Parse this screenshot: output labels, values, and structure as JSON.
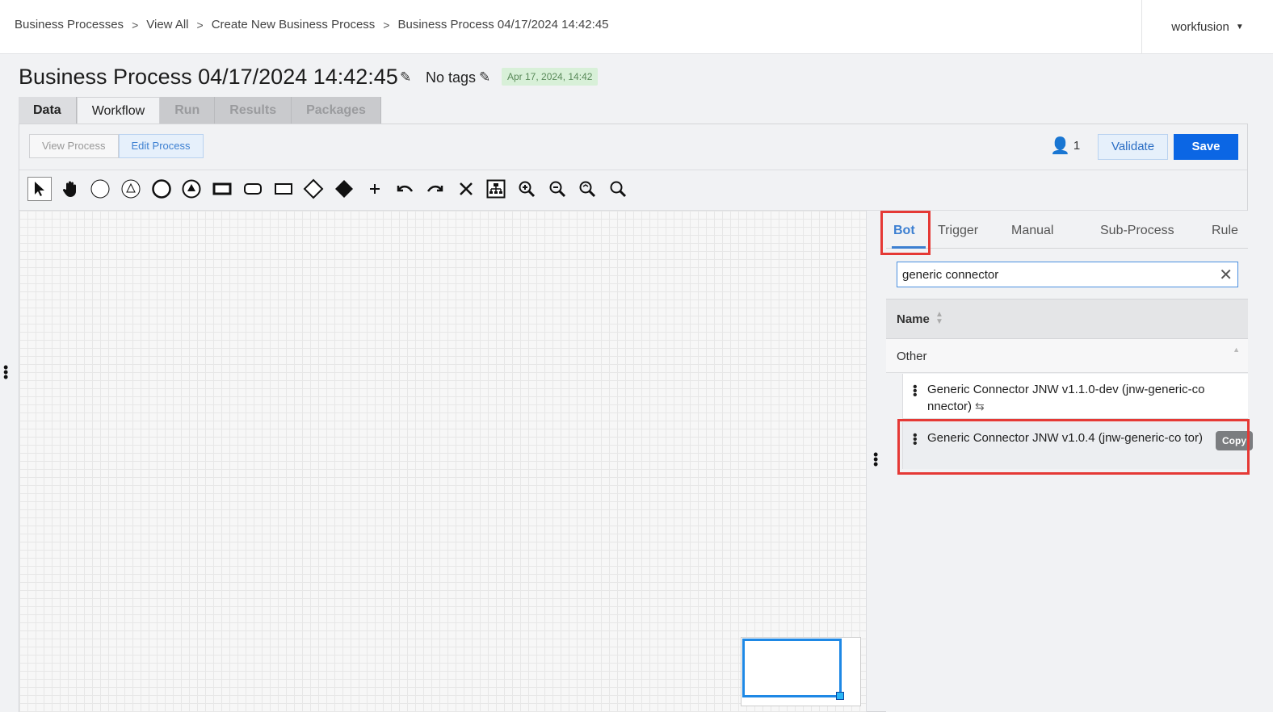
{
  "breadcrumb": [
    "Business Processes",
    "View All",
    "Create New Business Process",
    "Business Process 04/17/2024 14:42:45"
  ],
  "user": {
    "name": "workfusion"
  },
  "title": "Business Process 04/17/2024 14:42:45",
  "tags_label": "No tags",
  "date_badge": "Apr 17, 2024, 14:42",
  "tabs": [
    "Data",
    "Workflow",
    "Run",
    "Results",
    "Packages"
  ],
  "active_tab": "Workflow",
  "process_toggle": {
    "view": "View Process",
    "edit": "Edit Process",
    "active": "Edit Process"
  },
  "editors_count": "1",
  "buttons": {
    "validate": "Validate",
    "save": "Save"
  },
  "tools": [
    "pointer-tool",
    "hand-tool",
    "start-event",
    "start-event-signal",
    "end-event",
    "end-event-signal",
    "task",
    "subprocess",
    "data-object",
    "gateway-exclusive",
    "gateway-filled",
    "add",
    "undo",
    "redo",
    "delete",
    "auto-layout",
    "zoom-in",
    "zoom-out",
    "zoom-fit",
    "zoom-reset"
  ],
  "right_panel": {
    "tabs": [
      "Bot",
      "Trigger",
      "Manual",
      "Sub-Process",
      "Rule"
    ],
    "active_tab": "Bot",
    "search_value": "generic connector",
    "column_name": "Name",
    "group": "Other",
    "items": [
      {
        "label": "Generic Connector JNW v1.1.0-dev (jnw-generic-co nnector)"
      },
      {
        "label": "Generic Connector JNW v1.0.4 (jnw-generic-co tor)",
        "badge": "Copy"
      }
    ]
  },
  "colors": {
    "accent": "#0b66e4",
    "highlight": "#e53935"
  }
}
